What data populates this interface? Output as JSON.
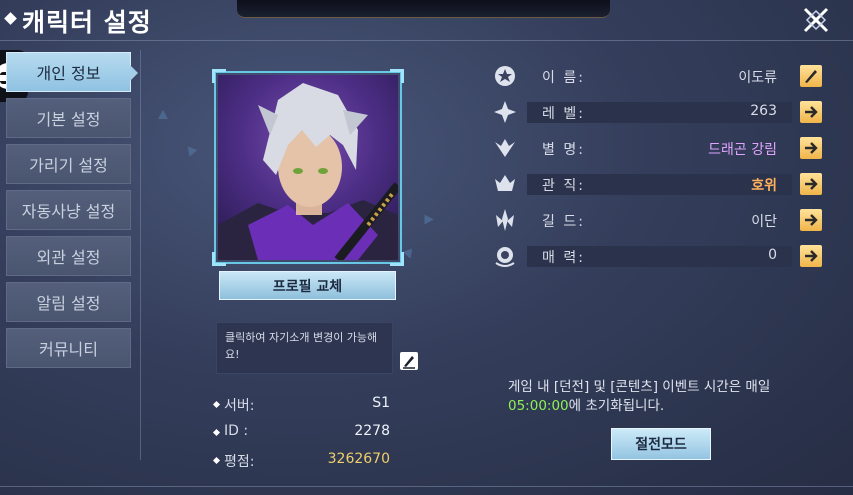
{
  "header": {
    "title": "캐릭터 설정"
  },
  "sidebar": {
    "items": [
      {
        "label": "개인 정보",
        "active": true
      },
      {
        "label": "기본 설정",
        "active": false
      },
      {
        "label": "가리기 설정",
        "active": false
      },
      {
        "label": "자동사냥 설정",
        "active": false
      },
      {
        "label": "외관 설정",
        "active": false
      },
      {
        "label": "알림 설정",
        "active": false
      },
      {
        "label": "커뮤니티",
        "active": false
      }
    ]
  },
  "profile": {
    "change_button": "프로필 교체",
    "intro_placeholder": "클릭하여 자기소개 변경이 가능해요!",
    "server_label": "서버:",
    "server_value": "S1",
    "id_label": "ID :",
    "id_value": "2278",
    "rating_label": "평점:",
    "rating_value": "3262670"
  },
  "info": {
    "rows": [
      {
        "label": "이   름:",
        "value": "이도류",
        "button": "edit-icon",
        "icon": "name-icon"
      },
      {
        "label": "레 벨:",
        "value": "263",
        "button": "arrow-right-icon",
        "icon": "level-icon"
      },
      {
        "label": "별   명:",
        "value": "드래곤 강림",
        "button": "arrow-right-icon",
        "icon": "nickname-icon"
      },
      {
        "label": "관   직:",
        "value": "호위",
        "button": "arrow-right-icon",
        "icon": "rank-icon"
      },
      {
        "label": "길   드:",
        "value": "이단",
        "button": "arrow-right-icon",
        "icon": "guild-icon"
      },
      {
        "label": "매   력:",
        "value": "0",
        "button": "arrow-right-icon",
        "icon": "charm-icon"
      }
    ]
  },
  "notice": {
    "line1": "게임 내 [던전] 및 [콘텐츠] 이벤트 시간은 매일",
    "time": "05:00:00",
    "line2": "에 초기화됩니다."
  },
  "buttons": {
    "full_mode": "절전모드"
  },
  "colors": {
    "accent": "#9fd0ee",
    "nickname": "#e1a4ff",
    "rank": "#ffb15a",
    "rating": "#f0cf6a",
    "notice_time": "#8ff058",
    "action_button": "#f0b54a"
  }
}
